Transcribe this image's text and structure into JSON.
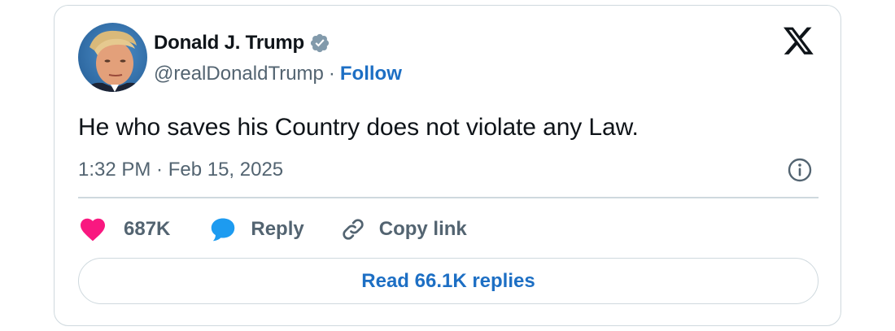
{
  "tweet": {
    "author_name": "Donald J. Trump",
    "handle": "@realDonaldTrump",
    "separator": "·",
    "follow_label": "Follow",
    "text": "He who saves his Country does not violate any Law.",
    "timestamp": "1:32 PM · Feb 15, 2025"
  },
  "actions": {
    "likes_count": "687K",
    "reply_label": "Reply",
    "copy_link_label": "Copy link"
  },
  "footer": {
    "read_replies_label": "Read 66.1K replies"
  },
  "icons": {
    "verified": "verified-badge-icon",
    "platform": "x-logo-icon",
    "info": "info-icon",
    "like": "heart-icon",
    "reply": "speech-bubble-icon",
    "copy_link": "link-icon"
  },
  "colors": {
    "follow_blue": "#1d6fc4",
    "like_pink": "#f91880",
    "reply_blue": "#1d9bf0",
    "muted_text": "#536471",
    "border": "#cfd9de"
  }
}
